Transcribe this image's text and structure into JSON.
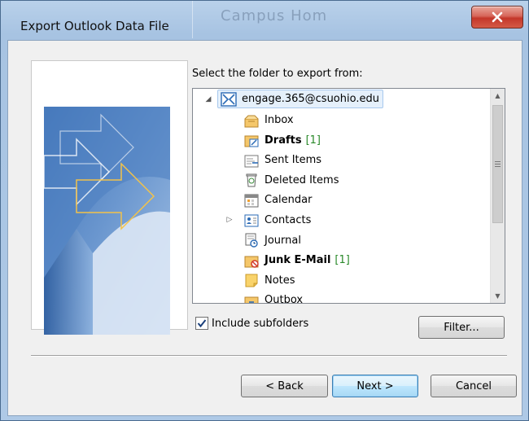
{
  "window": {
    "title": "Export Outlook Data File",
    "background_title": "Campus Hom"
  },
  "dialog": {
    "prompt": "Select the folder to export from:",
    "root": {
      "label": "engage.365@csuohio.edu",
      "expanded": true,
      "selected": true
    },
    "folders": [
      {
        "label": "Inbox",
        "icon": "inbox-icon",
        "bold": false,
        "count": "",
        "expander": false
      },
      {
        "label": "Drafts",
        "icon": "drafts-icon",
        "bold": true,
        "count": "[1]",
        "expander": false
      },
      {
        "label": "Sent Items",
        "icon": "sent-items-icon",
        "bold": false,
        "count": "",
        "expander": false
      },
      {
        "label": "Deleted Items",
        "icon": "deleted-items-icon",
        "bold": false,
        "count": "",
        "expander": false
      },
      {
        "label": "Calendar",
        "icon": "calendar-icon",
        "bold": false,
        "count": "",
        "expander": false
      },
      {
        "label": "Contacts",
        "icon": "contacts-icon",
        "bold": false,
        "count": "",
        "expander": true
      },
      {
        "label": "Journal",
        "icon": "journal-icon",
        "bold": false,
        "count": "",
        "expander": false
      },
      {
        "label": "Junk E-Mail",
        "icon": "junk-email-icon",
        "bold": true,
        "count": "[1]",
        "expander": false
      },
      {
        "label": "Notes",
        "icon": "notes-icon",
        "bold": false,
        "count": "",
        "expander": false
      },
      {
        "label": "Outbox",
        "icon": "outbox-icon",
        "bold": false,
        "count": "",
        "expander": false
      }
    ],
    "include_subfolders": {
      "label": "Include subfolders",
      "checked": true
    },
    "buttons": {
      "filter": "Filter...",
      "back": "< Back",
      "next": "Next >",
      "cancel": "Cancel"
    }
  },
  "colors": {
    "count_green": "#2b8a2b",
    "selection": "#e5f0fb",
    "close_red": "#c4372a"
  }
}
